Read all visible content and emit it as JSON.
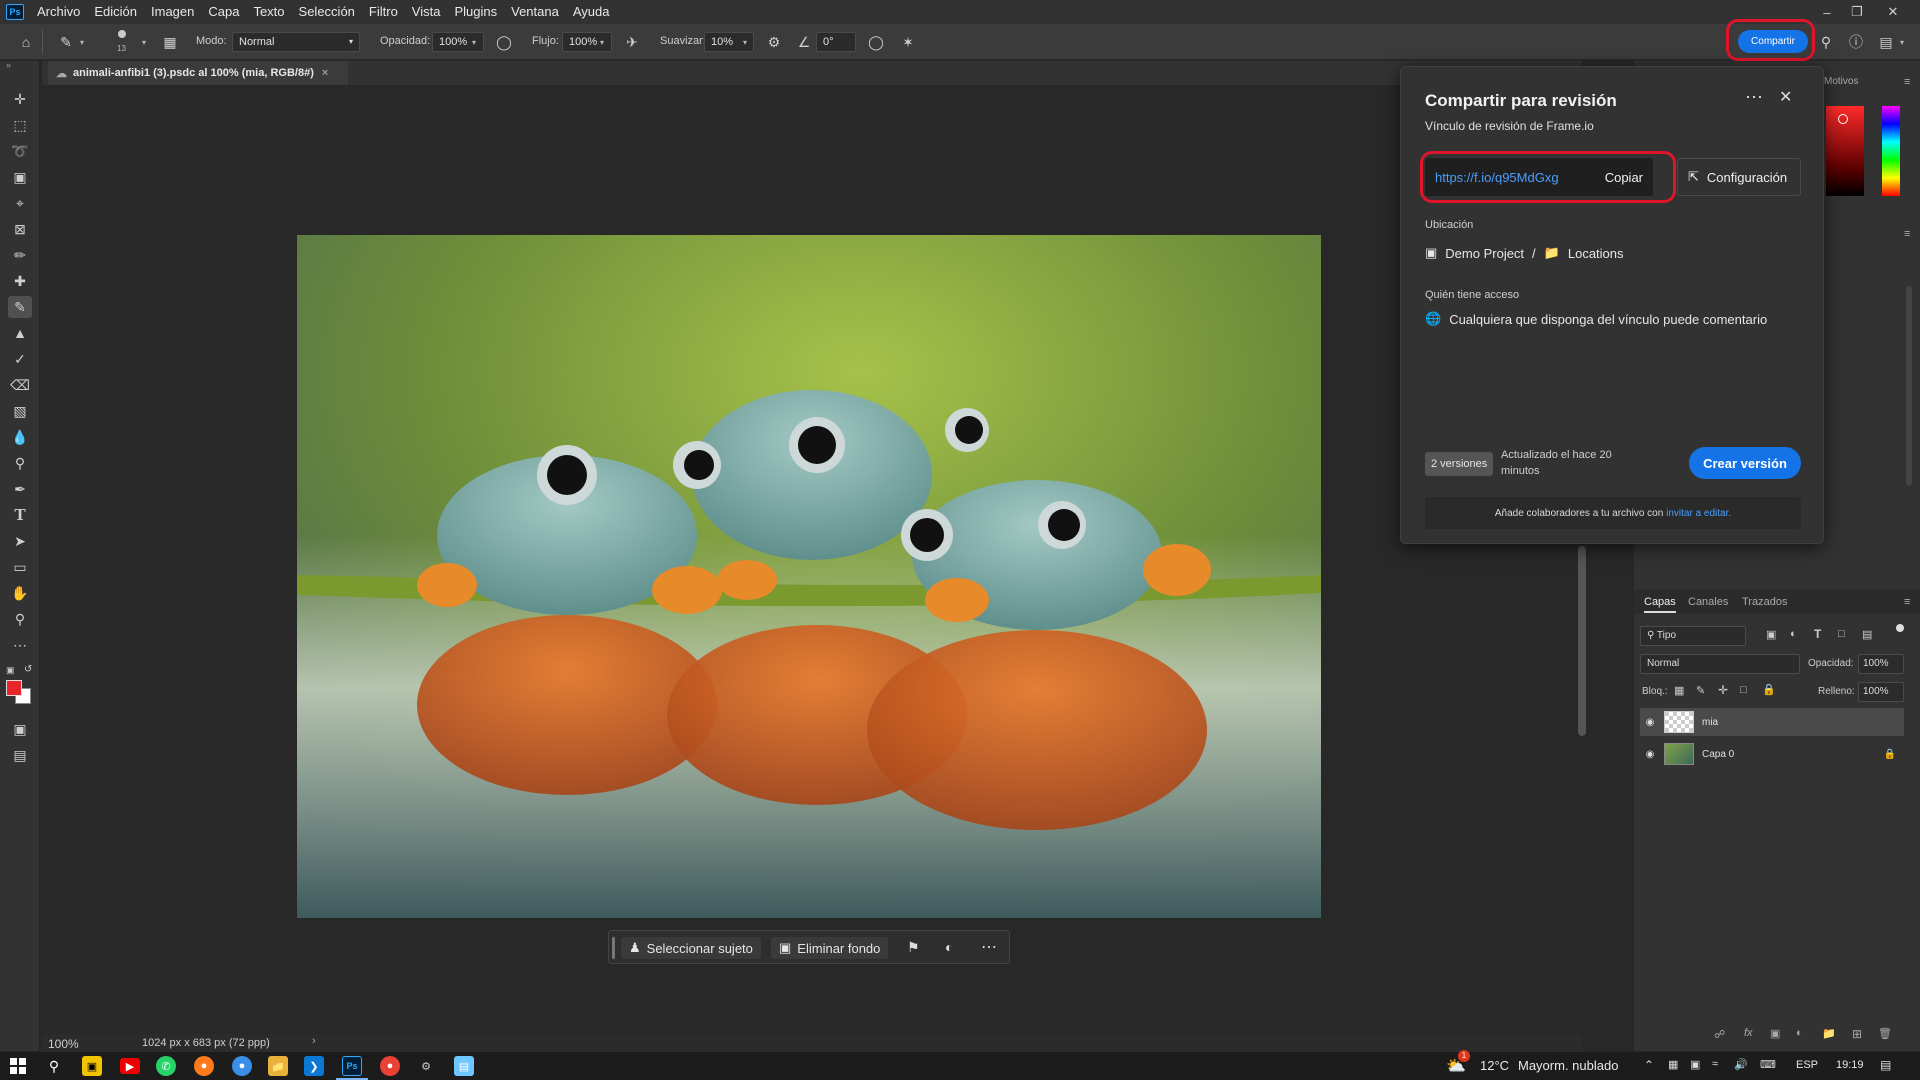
{
  "app": {
    "logo": "Ps",
    "menu": [
      "Archivo",
      "Edición",
      "Imagen",
      "Capa",
      "Texto",
      "Selección",
      "Filtro",
      "Vista",
      "Plugins",
      "Ventana",
      "Ayuda"
    ]
  },
  "options_bar": {
    "brush_size": "13",
    "mode_label": "Modo:",
    "mode_value": "Normal",
    "opacity_label": "Opacidad:",
    "opacity_value": "100%",
    "flow_label": "Flujo:",
    "flow_value": "100%",
    "smooth_label": "Suavizar:",
    "smooth_value": "10%",
    "angle_value": "0°",
    "share_button": "Compartir"
  },
  "document": {
    "tab_title": "animali-anfibi1 (3).psdc al 100% (mia, RGB/8#)",
    "zoom": "100%",
    "doc_info": "1024 px x 683 px (72 ppp)"
  },
  "context_bar": {
    "select_subject": "Seleccionar sujeto",
    "remove_bg": "Eliminar fondo"
  },
  "share_popover": {
    "title": "Compartir para revisión",
    "subtitle": "Vínculo de revisión de Frame.io",
    "link": "https://f.io/q95MdGxg",
    "copy": "Copiar",
    "config": "Configuración",
    "location_label": "Ubicación",
    "project": "Demo Project",
    "separator": "/",
    "folder": "Locations",
    "access_label": "Quién tiene acceso",
    "access_value": "Cualquiera que disponga del vínculo puede comentario",
    "versions": "2 versiones",
    "updated": "Actualizado el hace 20 minutos",
    "create_version": "Crear versión",
    "footer_text": "Añade colaboradores a tu archivo con ",
    "footer_link": "invitar a editar."
  },
  "right_panel": {
    "motivos_tab": "Motivos",
    "tabs": [
      "Capas",
      "Canales",
      "Trazados"
    ],
    "filter": "Tipo",
    "blend_mode": "Normal",
    "opacity_label": "Opacidad:",
    "opacity_value": "100%",
    "lock_label": "Bloq.:",
    "fill_label": "Relleno:",
    "fill_value": "100%",
    "layers": [
      {
        "name": "mia"
      },
      {
        "name": "Capa 0"
      }
    ]
  },
  "taskbar": {
    "temperature": "12°C",
    "weather": "Mayorm. nublado",
    "lang": "ESP",
    "time": "19:19",
    "notification_count": "1"
  },
  "colors": {
    "accent": "#1473e6",
    "highlight_ring": "#e0142a",
    "foreground_swatch": "#e8262a"
  }
}
